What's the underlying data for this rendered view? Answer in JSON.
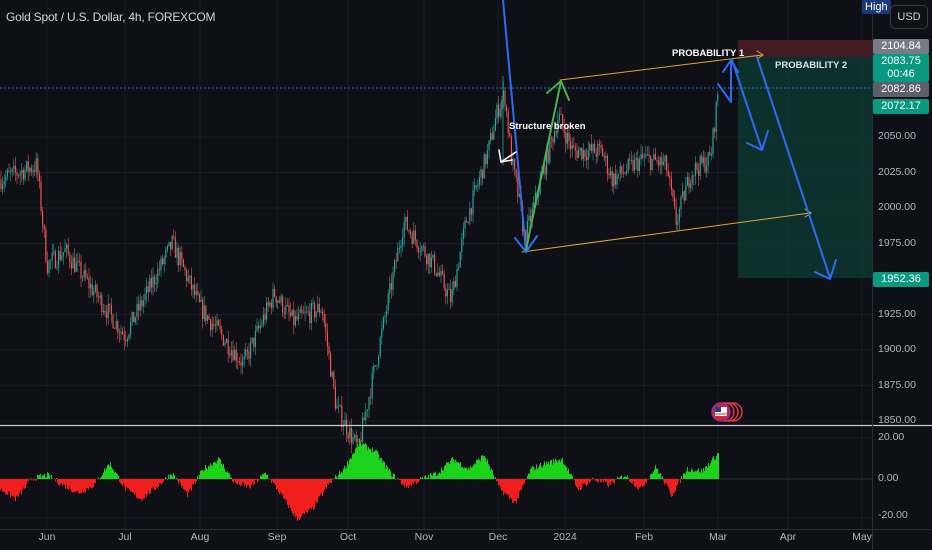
{
  "header": {
    "title": "Gold Spot / U.S. Dollar, 4h, FOREXCOM",
    "high_badge": "High",
    "currency": "USD"
  },
  "price_boxes": [
    {
      "label": "2104.84",
      "color": "#787b86"
    },
    {
      "label": "2083.75",
      "sub": "00:46",
      "color": "#089981"
    },
    {
      "label": "2082.86",
      "color": "#5d606b"
    },
    {
      "label": "2072.17",
      "color": "#089981"
    },
    {
      "label": "1952.36",
      "color": "#089981"
    }
  ],
  "annotations": {
    "structure": "Structure broken",
    "prob1": "PROBABILITY 1",
    "prob2": "PROBABILITY 2"
  },
  "colors": {
    "up": "#26a69a",
    "down": "#ef5350",
    "osc_up": "#1bd31b",
    "osc_down": "#f21d1d",
    "arrow_blue": "#2f6bf0",
    "arrow_green": "#4caf50",
    "channel": "#d8a63a"
  },
  "chart_data": [
    {
      "type": "candlestick",
      "title": "Gold Spot / U.S. Dollar, 4h, FOREXCOM",
      "ylim": [
        1850,
        2110
      ],
      "y_ticks": [
        "2050.00",
        "2025.00",
        "2000.00",
        "1975.00",
        "1925.00",
        "1900.00",
        "1875.00",
        "1850.00"
      ],
      "y_tick_values": [
        2050,
        2025,
        2000,
        1975,
        1925,
        1900,
        1875,
        1850
      ],
      "x_ticks": [
        "Jun",
        "Jul",
        "Aug",
        "Sep",
        "Oct",
        "Nov",
        "Dec",
        "2024",
        "Feb",
        "Mar",
        "Apr",
        "May"
      ],
      "close_path_note": "approximate closing-price path by date",
      "path": [
        [
          "May 25",
          2020
        ],
        [
          "May 27",
          2030
        ],
        [
          "Jun 1",
          1960
        ],
        [
          "Jun 8",
          1970
        ],
        [
          "Jul 1",
          1910
        ],
        [
          "Jul 20",
          1975
        ],
        [
          "Aug 1",
          1930
        ],
        [
          "Aug 18",
          1890
        ],
        [
          "Aug 30",
          1940
        ],
        [
          "Sep 8",
          1920
        ],
        [
          "Sep 20",
          1930
        ],
        [
          "Sep 26",
          1860
        ],
        [
          "Oct 5",
          1830
        ],
        [
          "Oct 13",
          1900
        ],
        [
          "Oct 23",
          1990
        ],
        [
          "Nov 5",
          1960
        ],
        [
          "Nov 12",
          1935
        ],
        [
          "Nov 18",
          1990
        ],
        [
          "Nov 27",
          2040
        ],
        [
          "Dec 1",
          2070
        ],
        [
          "Dec 4",
          2080
        ],
        [
          "Dec 7",
          2035
        ],
        [
          "Dec 11",
          2000
        ],
        [
          "Dec 13",
          1978
        ],
        [
          "Dec 22",
          2030
        ],
        [
          "Dec 28",
          2065
        ],
        [
          "Jan 4",
          2040
        ],
        [
          "Jan 15",
          2040
        ],
        [
          "Jan 19",
          2020
        ],
        [
          "Feb 1",
          2035
        ],
        [
          "Feb 10",
          2030
        ],
        [
          "Feb 14",
          1990
        ],
        [
          "Feb 20",
          2025
        ],
        [
          "Feb 28",
          2035
        ],
        [
          "Mar 1",
          2082
        ]
      ],
      "last_price": 2083.75,
      "target_high": 2104.84,
      "target_low": 1952.36
    },
    {
      "type": "histogram",
      "name": "oscillator",
      "ylim": [
        -20,
        20
      ],
      "y_ticks": [
        "20.00",
        "0.00",
        "-20.00"
      ],
      "values": [
        -5,
        -10,
        0,
        2,
        -3,
        -7,
        -3,
        8,
        -5,
        -10,
        -4,
        3,
        -8,
        5,
        10,
        -2,
        -4,
        3,
        -8,
        -20,
        -15,
        -3,
        5,
        18,
        14,
        3,
        -4,
        0,
        3,
        10,
        5,
        12,
        -5,
        -12,
        5,
        8,
        10,
        -5,
        0,
        -3,
        2,
        -5,
        6,
        -8,
        5,
        4,
        13
      ]
    }
  ]
}
